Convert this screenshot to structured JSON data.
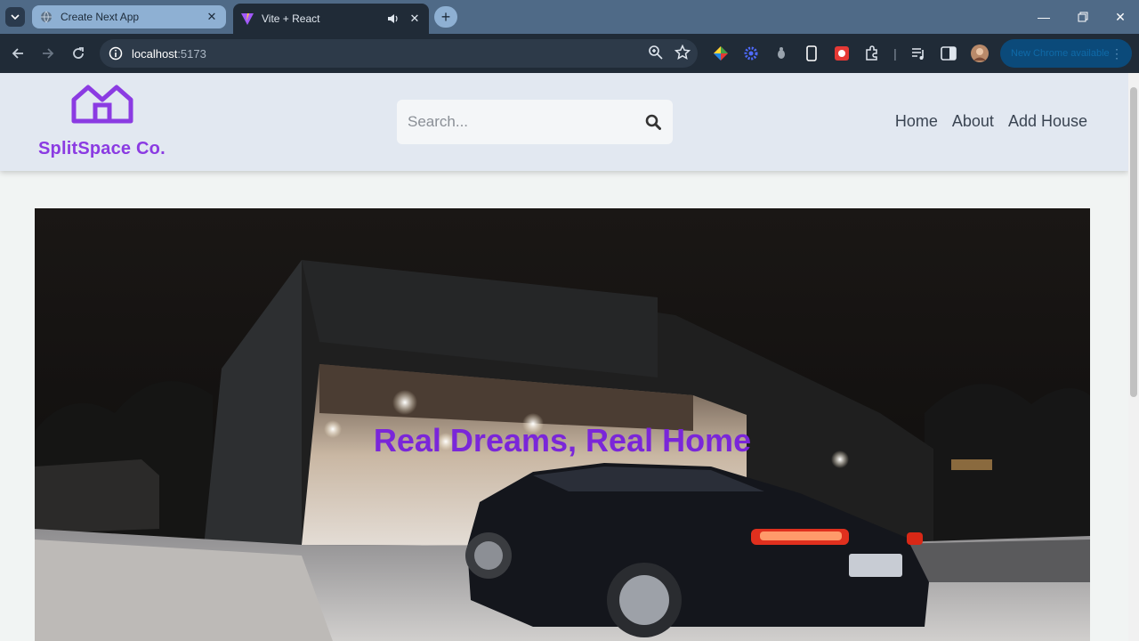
{
  "browser": {
    "tabs": [
      {
        "title": "Create Next App"
      },
      {
        "title": "Vite + React"
      }
    ],
    "url": {
      "host": "localhost",
      "port": ":5173"
    },
    "update_label": "New Chrome available"
  },
  "site": {
    "brand": "SplitSpace Co.",
    "search_placeholder": "Search...",
    "nav": [
      "Home",
      "About",
      "Add House"
    ],
    "hero_title": "Real Dreams, Real Home",
    "colors": {
      "brand": "#8b3be2",
      "hero_title": "#7a26d9",
      "header_bg": "#e2e8f1"
    }
  }
}
